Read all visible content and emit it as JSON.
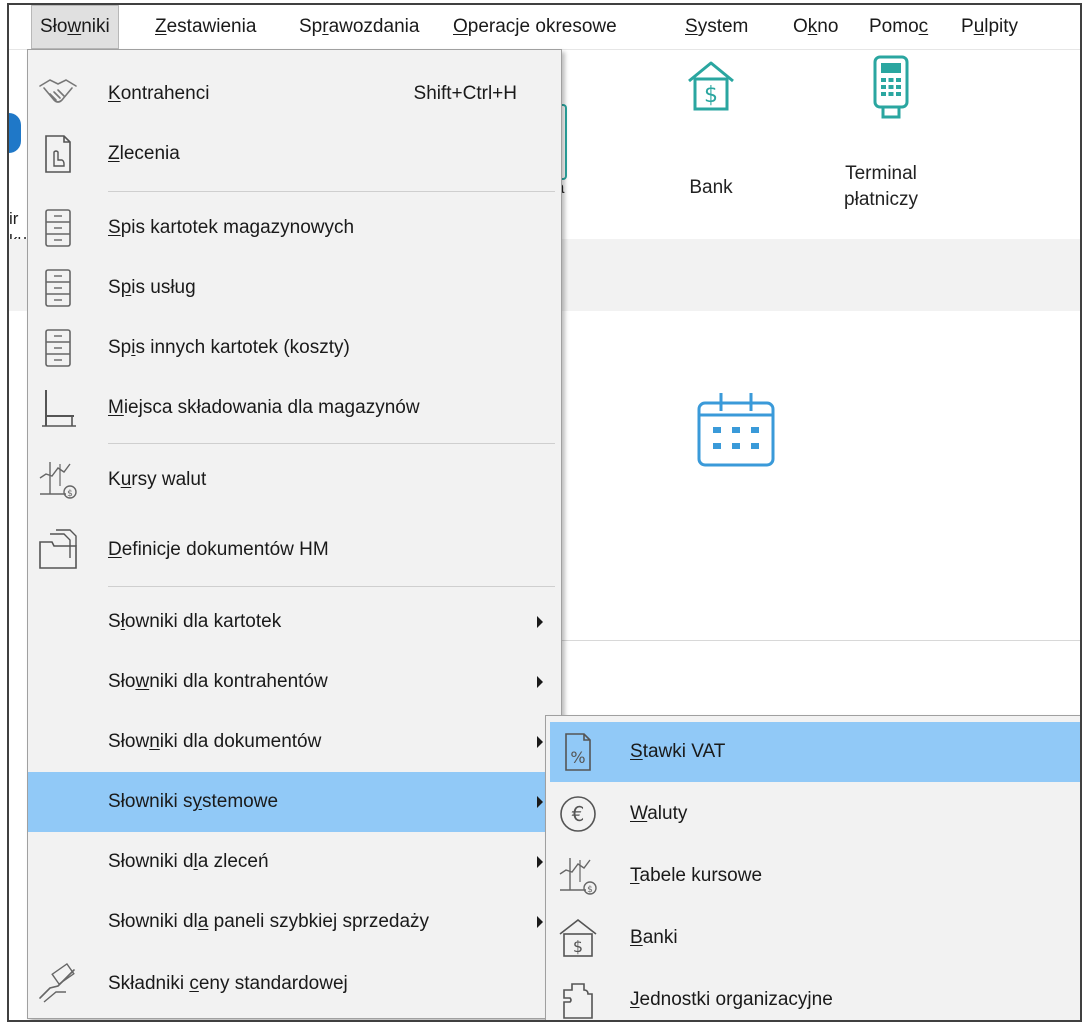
{
  "menubar": {
    "items": [
      {
        "label": "Słowniki",
        "pre": "Sło",
        "ul": "w",
        "post": "niki"
      },
      {
        "label": "Zestawienia",
        "pre": "",
        "ul": "Z",
        "post": "estawienia"
      },
      {
        "label": "Sprawozdania",
        "pre": "Sp",
        "ul": "r",
        "post": "awozdania"
      },
      {
        "label": "Operacje okresowe",
        "pre": "",
        "ul": "O",
        "post": "peracje okresowe"
      },
      {
        "label": "System",
        "pre": "",
        "ul": "S",
        "post": "ystem"
      },
      {
        "label": "Okno",
        "pre": "O",
        "ul": "k",
        "post": "no"
      },
      {
        "label": "Pomoc",
        "pre": "Pomo",
        "ul": "c",
        "post": ""
      },
      {
        "label": "Pulpity",
        "pre": "P",
        "ul": "u",
        "post": "lpity"
      }
    ]
  },
  "background": {
    "bank_label": "Bank",
    "terminal_label_1": "Terminal",
    "terminal_label_2": "płatniczy",
    "edge_text_1": "ir",
    "edge_text_2": "ku",
    "partial_label": "a"
  },
  "main_menu": {
    "items": [
      {
        "pre": "",
        "ul": "K",
        "post": "ontrahenci",
        "shortcut": "Shift+Ctrl+H",
        "icon": "handshake-icon"
      },
      {
        "pre": "",
        "ul": "Z",
        "post": "lecenia",
        "icon": "document-hand-icon"
      },
      {
        "pre": "",
        "ul": "S",
        "post": "pis kartotek magazynowych",
        "icon": "filing-cabinet-icon"
      },
      {
        "pre": "S",
        "ul": "p",
        "post": "is usług",
        "icon": "filing-cabinet-icon"
      },
      {
        "pre": "Sp",
        "ul": "i",
        "post": "s innych kartotek (koszty)",
        "icon": "filing-cabinet-icon"
      },
      {
        "pre": "",
        "ul": "M",
        "post": "iejsca składowania dla magazynów",
        "icon": "shelf-icon"
      },
      {
        "pre": "K",
        "ul": "u",
        "post": "rsy walut",
        "icon": "currency-rates-icon"
      },
      {
        "pre": "",
        "ul": "D",
        "post": "efinicje dokumentów HM",
        "icon": "documents-folder-icon"
      },
      {
        "pre": "S",
        "ul": "ł",
        "post": "owniki dla kartotek",
        "submenu": true
      },
      {
        "pre": "Sło",
        "ul": "w",
        "post": "niki dla kontrahentów",
        "submenu": true
      },
      {
        "pre": "Słow",
        "ul": "n",
        "post": "iki dla dokumentów",
        "submenu": true
      },
      {
        "pre": "Słowniki s",
        "ul": "y",
        "post": "stemowe",
        "submenu": true,
        "highlighted": true
      },
      {
        "pre": "Słowniki d",
        "ul": "l",
        "post": "a zleceń",
        "submenu": true
      },
      {
        "pre": "Słowniki dl",
        "ul": "a",
        "post": " paneli szybkiej sprzedaży",
        "submenu": true
      },
      {
        "pre": "Składniki ",
        "ul": "c",
        "post": "eny standardowej",
        "icon": "price-hand-icon"
      }
    ]
  },
  "sub_menu": {
    "items": [
      {
        "pre": "",
        "ul": "S",
        "post": "tawki VAT",
        "icon": "vat-rate-icon",
        "highlighted": true
      },
      {
        "pre": "",
        "ul": "W",
        "post": "aluty",
        "icon": "euro-icon"
      },
      {
        "pre": "",
        "ul": "T",
        "post": "abele kursowe",
        "icon": "exchange-table-icon"
      },
      {
        "pre": "",
        "ul": "B",
        "post": "anki",
        "icon": "bank-icon"
      },
      {
        "pre": "",
        "ul": "J",
        "post": "ednostki organizacyjne",
        "icon": "org-units-icon"
      }
    ]
  },
  "colors": {
    "highlight": "#91c9f7",
    "menu_bg": "#f2f2f2",
    "accent_teal": "#2aa6a0",
    "calendar_blue": "#3a9ad9"
  }
}
